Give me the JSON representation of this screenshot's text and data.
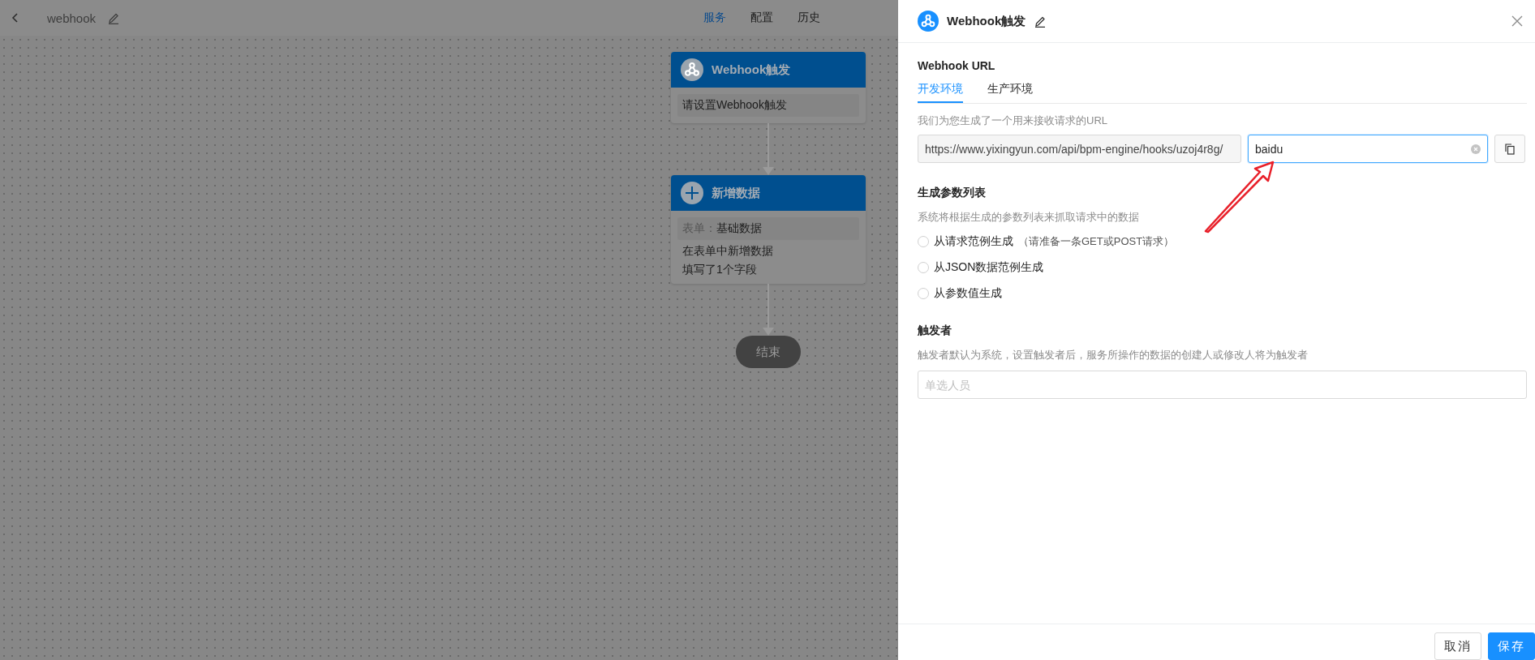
{
  "topbar": {
    "title": "webhook",
    "tabs": [
      {
        "label": "服务",
        "selected": true
      },
      {
        "label": "配置",
        "selected": false
      },
      {
        "label": "历史",
        "selected": false
      }
    ]
  },
  "flow": {
    "nodes": [
      {
        "kind": "trigger",
        "title": "Webhook触发",
        "summary": {
          "value": "请设置Webhook触发"
        }
      },
      {
        "kind": "add",
        "title": "新增数据",
        "summary": {
          "label": "表单：",
          "value": "基础数据"
        },
        "lines": [
          "在表单中新增数据",
          "填写了1个字段"
        ]
      }
    ],
    "end": "结束"
  },
  "panel": {
    "title": "Webhook触发",
    "url_section": {
      "heading": "Webhook URL",
      "tabs": [
        {
          "label": "开发环境",
          "selected": true
        },
        {
          "label": "生产环境",
          "selected": false
        }
      ],
      "hint": "我们为您生成了一个用来接收请求的URL",
      "url": "https://www.yixingyun.com/api/bpm-engine/hooks/uzoj4r8g/",
      "path_value": "baidu"
    },
    "params": {
      "heading": "生成参数列表",
      "hint": "系统将根据生成的参数列表来抓取请求中的数据",
      "options": [
        {
          "label": "从请求范例生成",
          "note": "（请准备一条GET或POST请求）",
          "selected": false
        },
        {
          "label": "从JSON数据范例生成",
          "selected": false
        },
        {
          "label": "从参数值生成",
          "selected": false
        }
      ]
    },
    "trigger": {
      "heading": "触发者",
      "hint": "触发者默认为系统，设置触发者后，服务所操作的数据的创建人或修改人将为触发者",
      "placeholder": "单选人员"
    },
    "buttons": [
      {
        "label": "取消",
        "kind": "default"
      },
      {
        "label": "保存",
        "kind": "primary"
      }
    ]
  }
}
